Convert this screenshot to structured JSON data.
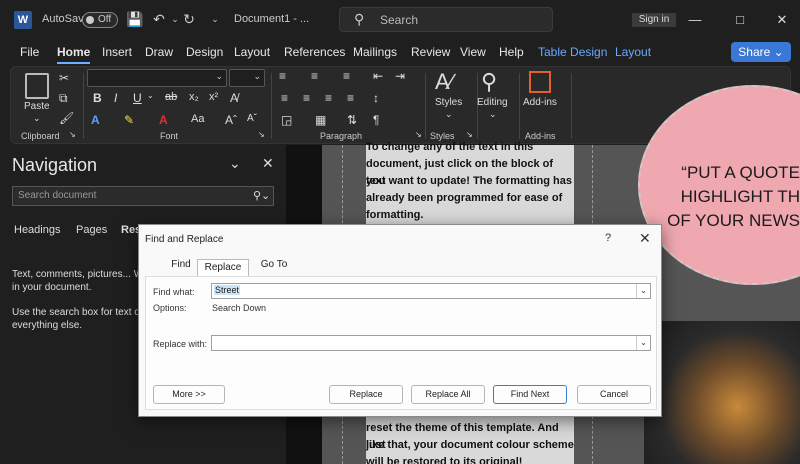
{
  "titlebar": {
    "autosave_label": "AutoSave",
    "autosave_state": "Off",
    "doc_title": "Document1 - ...",
    "search_placeholder": "Search",
    "signin_label": "Sign in"
  },
  "menu": {
    "tabs": [
      "File",
      "Home",
      "Insert",
      "Draw",
      "Design",
      "Layout",
      "References",
      "Mailings",
      "Review",
      "View",
      "Help",
      "Table Design",
      "Layout"
    ],
    "active": "Home",
    "share_label": "Share"
  },
  "ribbon": {
    "paste_label": "Paste",
    "groups": [
      "Clipboard",
      "Font",
      "Paragraph",
      "Styles",
      "Add-ins"
    ],
    "styles_label": "Styles",
    "editing_label": "Editing",
    "addins_label": "Add-ins"
  },
  "nav": {
    "title": "Navigation",
    "search_placeholder": "Search document",
    "tabs": [
      "Headings",
      "Pages",
      "Res"
    ],
    "line1": "Text, comments, pictures... We",
    "line2": "in your document.",
    "line3": "Use the search box for text or",
    "line4": "everything else."
  },
  "document": {
    "para_top_lines": [
      "To change any of the text in this",
      "document, just click on the block of text",
      "you want to update! The formatting has",
      "already been programmed for ease of",
      "formatting."
    ],
    "para_bottom_lines": [
      "reset the theme of this template. And just",
      "like that, your document colour scheme",
      "will be restored to its original!"
    ],
    "quote_lines": [
      "“PUT A QUOTE",
      "HIGHLIGHT TH",
      "OF YOUR NEWS"
    ]
  },
  "dialog": {
    "title": "Find and Replace",
    "help": "?",
    "tabs": [
      "Find",
      "Replace",
      "Go To"
    ],
    "active_tab": "Replace",
    "find_label": "Find what:",
    "find_value": "Street",
    "options_label": "Options:",
    "options_value": "Search Down",
    "replace_label": "Replace with:",
    "replace_value": "",
    "buttons": {
      "more": "More >>",
      "replace": "Replace",
      "replace_all": "Replace All",
      "find_next": "Find Next",
      "cancel": "Cancel"
    }
  },
  "colors": {
    "accent": "#3a77d6",
    "context_tab": "#6aa8ff",
    "quote_bg": "#f0a8b0"
  }
}
